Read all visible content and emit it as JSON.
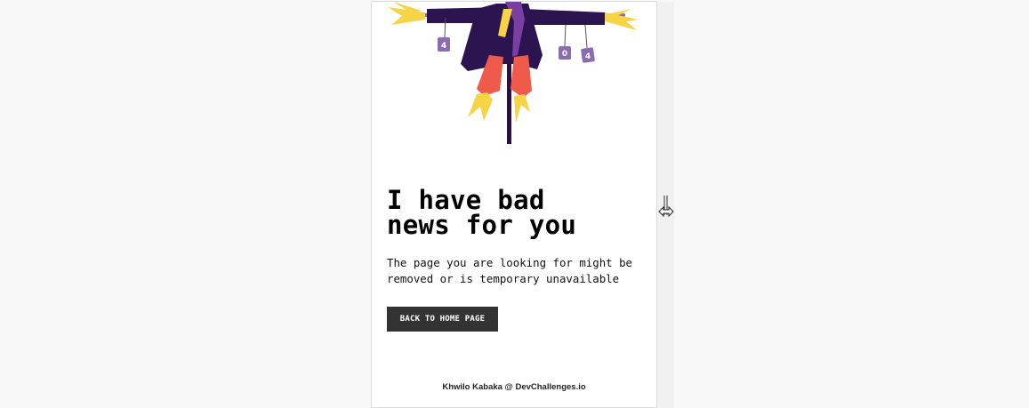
{
  "illustration": {
    "icon": "scarecrow-404-illustration",
    "can_labels": [
      "4",
      "0",
      "4"
    ],
    "colors": {
      "coat": "#2c1451",
      "hat_and_cans": "#8a6db1",
      "straw": "#f7d445",
      "pants": "#ef5a4a",
      "scarf": "#7a3fa0",
      "pole": "#2a1240"
    }
  },
  "content": {
    "headline_line1": "I have bad",
    "headline_line2": "news for you",
    "message_line1": "The page you are looking for might be",
    "message_line2": "removed or is temporary unavailable",
    "button_label": "BACK TO HOME PAGE"
  },
  "footer": {
    "credit": "Khwilo Kabaka @ DevChallenges.io"
  },
  "resize_handle": {
    "icon": "horizontal-resize-icon"
  }
}
